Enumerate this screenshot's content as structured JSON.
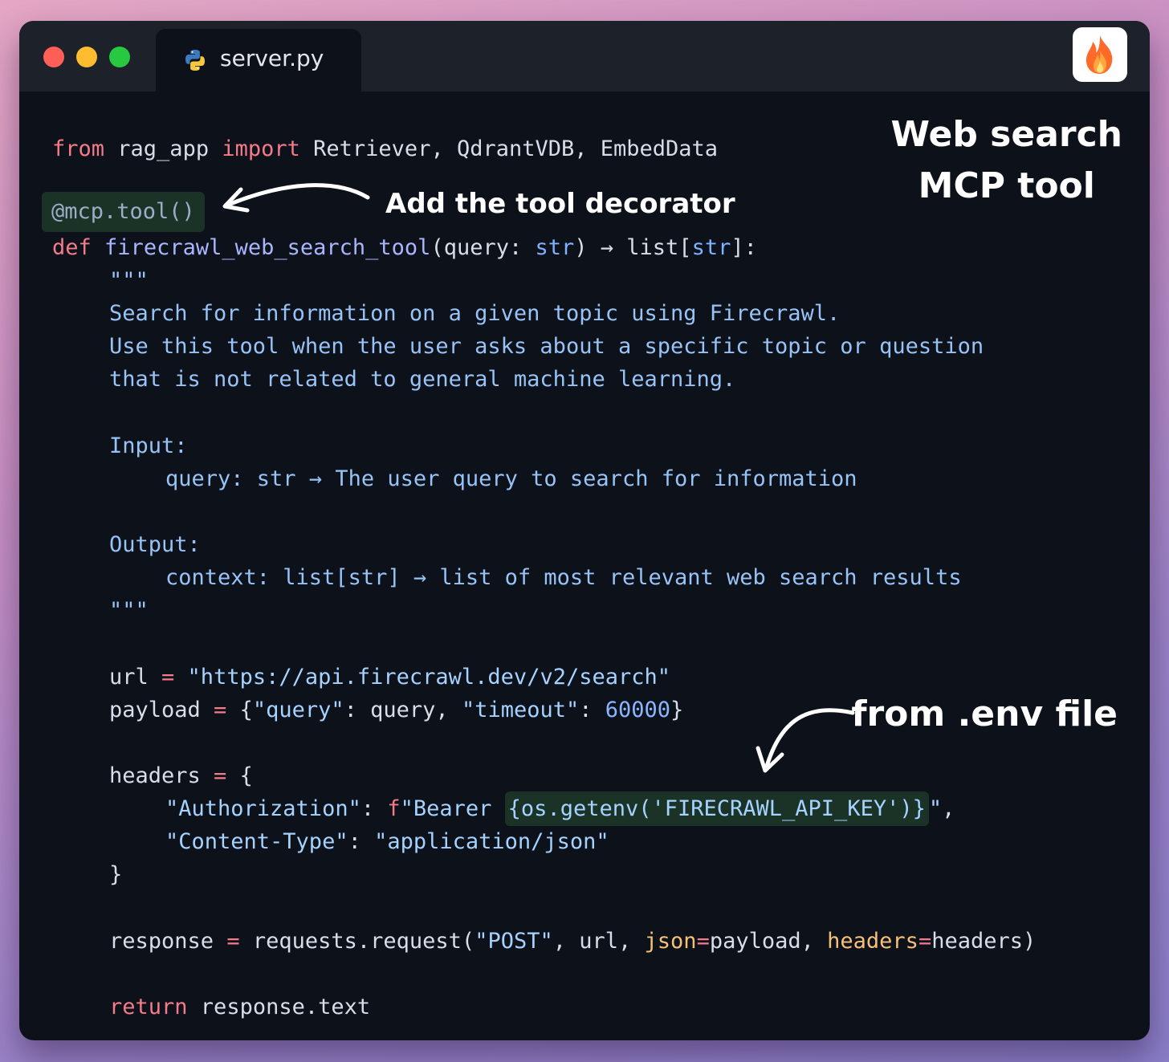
{
  "window": {
    "tab": {
      "filename": "server.py",
      "icon": "python-icon"
    },
    "brand_icon": "fire-icon",
    "traffic_lights": [
      "close",
      "minimize",
      "maximize"
    ]
  },
  "code": {
    "l1": {
      "kw_from": "from",
      "module": " rag_app ",
      "kw_import": "import",
      "names": " Retriever, QdrantVDB, EmbedData"
    },
    "l2": {
      "decorator": "@mcp.tool()"
    },
    "l3": {
      "kw_def": "def",
      "fname": "firecrawl_web_search_tool",
      "open": "(query: ",
      "type1": "str",
      "close_arrow": ") → list[",
      "type2": "str",
      "end": "]:"
    },
    "l4": {
      "text": "\"\"\""
    },
    "l5": {
      "text": "Search for information on a given topic using Firecrawl."
    },
    "l6": {
      "text": "Use this tool when the user asks about a specific topic or question"
    },
    "l7": {
      "text": "that is not related to general machine learning."
    },
    "l8": {
      "text": "Input:"
    },
    "l9": {
      "text": "query: str → The user query to search for information"
    },
    "l10": {
      "text": "Output:"
    },
    "l11": {
      "text": "context: list[str] → list of most relevant web search results"
    },
    "l12": {
      "text": "\"\"\""
    },
    "l13": {
      "var": "url ",
      "eq": "=",
      "value": " \"https://api.firecrawl.dev/v2/search\""
    },
    "l14": {
      "var": "payload ",
      "eq": "=",
      "p1": " {",
      "k1": "\"query\"",
      "p2": ": query, ",
      "k2": "\"timeout\"",
      "p3": ": ",
      "num": "60000",
      "p4": "}"
    },
    "l15": {
      "var": "headers ",
      "eq": "=",
      "rest": " {"
    },
    "l16": {
      "key": "\"Authorization\"",
      "colon": ": ",
      "fprefix": "f",
      "s1": "\"Bearer ",
      "expr": "{os.getenv(",
      "envkey": "'FIRECRAWL_API_KEY'",
      "expr_end": ")}",
      "s2": "\"",
      "comma": ","
    },
    "l17": {
      "key": "\"Content-Type\"",
      "colon": ": ",
      "value": "\"application/json\""
    },
    "l18": {
      "text": "}"
    },
    "l19": {
      "var": "response ",
      "eq": "=",
      "call": " requests.request(",
      "method": "\"POST\"",
      "mid": ", url, ",
      "p_json": "json",
      "eq2": "=",
      "payload": "payload, ",
      "p_headers": "headers",
      "eq3": "=",
      "end": "headers)"
    },
    "l20": {
      "kw_return": "return",
      "rest": " response.text"
    }
  },
  "annotations": {
    "title_line1": "Web search",
    "title_line2": "MCP tool",
    "decorator_note": "Add the tool decorator",
    "env_note": "from .env file"
  }
}
